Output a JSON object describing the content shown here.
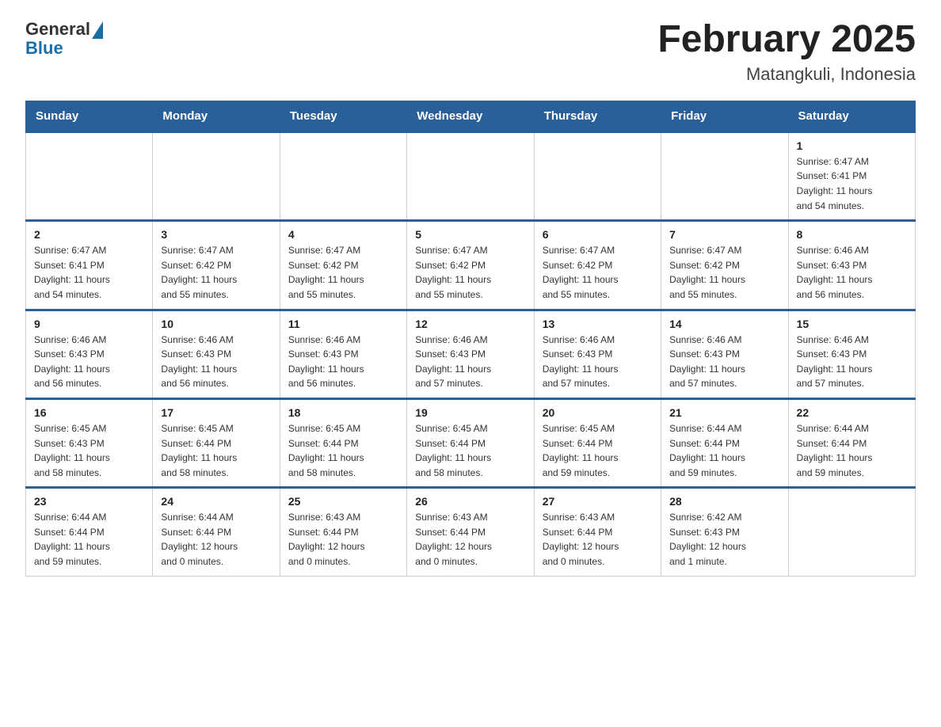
{
  "header": {
    "logo": {
      "general": "General",
      "blue": "Blue"
    },
    "title": "February 2025",
    "location": "Matangkuli, Indonesia"
  },
  "weekdays": [
    "Sunday",
    "Monday",
    "Tuesday",
    "Wednesday",
    "Thursday",
    "Friday",
    "Saturday"
  ],
  "weeks": [
    [
      {
        "day": "",
        "info": ""
      },
      {
        "day": "",
        "info": ""
      },
      {
        "day": "",
        "info": ""
      },
      {
        "day": "",
        "info": ""
      },
      {
        "day": "",
        "info": ""
      },
      {
        "day": "",
        "info": ""
      },
      {
        "day": "1",
        "info": "Sunrise: 6:47 AM\nSunset: 6:41 PM\nDaylight: 11 hours\nand 54 minutes."
      }
    ],
    [
      {
        "day": "2",
        "info": "Sunrise: 6:47 AM\nSunset: 6:41 PM\nDaylight: 11 hours\nand 54 minutes."
      },
      {
        "day": "3",
        "info": "Sunrise: 6:47 AM\nSunset: 6:42 PM\nDaylight: 11 hours\nand 55 minutes."
      },
      {
        "day": "4",
        "info": "Sunrise: 6:47 AM\nSunset: 6:42 PM\nDaylight: 11 hours\nand 55 minutes."
      },
      {
        "day": "5",
        "info": "Sunrise: 6:47 AM\nSunset: 6:42 PM\nDaylight: 11 hours\nand 55 minutes."
      },
      {
        "day": "6",
        "info": "Sunrise: 6:47 AM\nSunset: 6:42 PM\nDaylight: 11 hours\nand 55 minutes."
      },
      {
        "day": "7",
        "info": "Sunrise: 6:47 AM\nSunset: 6:42 PM\nDaylight: 11 hours\nand 55 minutes."
      },
      {
        "day": "8",
        "info": "Sunrise: 6:46 AM\nSunset: 6:43 PM\nDaylight: 11 hours\nand 56 minutes."
      }
    ],
    [
      {
        "day": "9",
        "info": "Sunrise: 6:46 AM\nSunset: 6:43 PM\nDaylight: 11 hours\nand 56 minutes."
      },
      {
        "day": "10",
        "info": "Sunrise: 6:46 AM\nSunset: 6:43 PM\nDaylight: 11 hours\nand 56 minutes."
      },
      {
        "day": "11",
        "info": "Sunrise: 6:46 AM\nSunset: 6:43 PM\nDaylight: 11 hours\nand 56 minutes."
      },
      {
        "day": "12",
        "info": "Sunrise: 6:46 AM\nSunset: 6:43 PM\nDaylight: 11 hours\nand 57 minutes."
      },
      {
        "day": "13",
        "info": "Sunrise: 6:46 AM\nSunset: 6:43 PM\nDaylight: 11 hours\nand 57 minutes."
      },
      {
        "day": "14",
        "info": "Sunrise: 6:46 AM\nSunset: 6:43 PM\nDaylight: 11 hours\nand 57 minutes."
      },
      {
        "day": "15",
        "info": "Sunrise: 6:46 AM\nSunset: 6:43 PM\nDaylight: 11 hours\nand 57 minutes."
      }
    ],
    [
      {
        "day": "16",
        "info": "Sunrise: 6:45 AM\nSunset: 6:43 PM\nDaylight: 11 hours\nand 58 minutes."
      },
      {
        "day": "17",
        "info": "Sunrise: 6:45 AM\nSunset: 6:44 PM\nDaylight: 11 hours\nand 58 minutes."
      },
      {
        "day": "18",
        "info": "Sunrise: 6:45 AM\nSunset: 6:44 PM\nDaylight: 11 hours\nand 58 minutes."
      },
      {
        "day": "19",
        "info": "Sunrise: 6:45 AM\nSunset: 6:44 PM\nDaylight: 11 hours\nand 58 minutes."
      },
      {
        "day": "20",
        "info": "Sunrise: 6:45 AM\nSunset: 6:44 PM\nDaylight: 11 hours\nand 59 minutes."
      },
      {
        "day": "21",
        "info": "Sunrise: 6:44 AM\nSunset: 6:44 PM\nDaylight: 11 hours\nand 59 minutes."
      },
      {
        "day": "22",
        "info": "Sunrise: 6:44 AM\nSunset: 6:44 PM\nDaylight: 11 hours\nand 59 minutes."
      }
    ],
    [
      {
        "day": "23",
        "info": "Sunrise: 6:44 AM\nSunset: 6:44 PM\nDaylight: 11 hours\nand 59 minutes."
      },
      {
        "day": "24",
        "info": "Sunrise: 6:44 AM\nSunset: 6:44 PM\nDaylight: 12 hours\nand 0 minutes."
      },
      {
        "day": "25",
        "info": "Sunrise: 6:43 AM\nSunset: 6:44 PM\nDaylight: 12 hours\nand 0 minutes."
      },
      {
        "day": "26",
        "info": "Sunrise: 6:43 AM\nSunset: 6:44 PM\nDaylight: 12 hours\nand 0 minutes."
      },
      {
        "day": "27",
        "info": "Sunrise: 6:43 AM\nSunset: 6:44 PM\nDaylight: 12 hours\nand 0 minutes."
      },
      {
        "day": "28",
        "info": "Sunrise: 6:42 AM\nSunset: 6:43 PM\nDaylight: 12 hours\nand 1 minute."
      },
      {
        "day": "",
        "info": ""
      }
    ]
  ]
}
